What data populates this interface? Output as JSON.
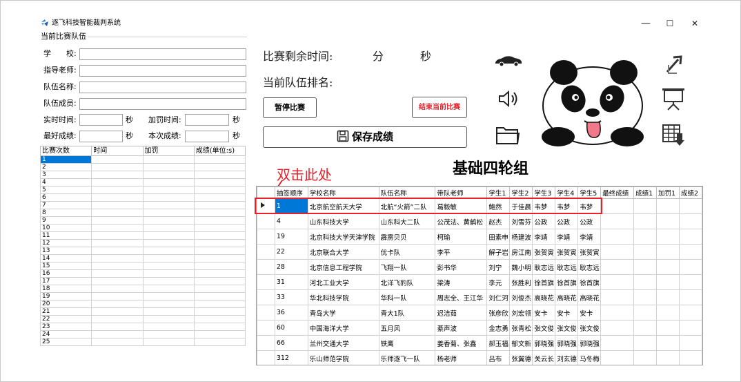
{
  "window": {
    "title": "逐飞科技智能裁判系统",
    "minimize": "—",
    "maximize": "☐",
    "close": "✕"
  },
  "left_panel": {
    "group_title": "当前比赛队伍",
    "school_label": "学　　校:",
    "teacher_label": "指导老师:",
    "team_name_label": "队伍名称:",
    "members_label": "队伍成员:",
    "realtime_label": "实时时间:",
    "penalty_time_label": "加罚时间:",
    "best_label": "最好成绩:",
    "this_label": "本次成绩:",
    "sec": "秒",
    "record_table": {
      "columns": [
        "比赛次数",
        "时间",
        "加罚",
        "成绩(单位:s)"
      ],
      "rows": [
        "1",
        "2",
        "3",
        "4",
        "5",
        "6",
        "7",
        "8",
        "9",
        "10",
        "11",
        "12",
        "13",
        "14",
        "15",
        "16",
        "17",
        "18",
        "19",
        "20",
        "21",
        "22",
        "23",
        "24",
        "25"
      ]
    }
  },
  "center": {
    "remaining_label": "比赛剩余时间:",
    "minute_unit": "分",
    "second_unit": "秒",
    "rank_label": "当前队伍排名:",
    "pause_button": "暂停比赛",
    "end_button": "结束当前比赛",
    "save_button": "保存成绩",
    "group_title": "基础四轮组",
    "annotation": "双击此处"
  },
  "grid": {
    "columns": [
      "抽签顺序",
      "学校名称",
      "队伍名称",
      "带队老师",
      "学生1",
      "学生2",
      "学生3",
      "学生4",
      "学生5",
      "最终成绩",
      "成绩1",
      "加罚1",
      "成绩2"
    ],
    "rows": [
      [
        "1",
        "北京航空航天大学",
        "北航“火箭”二队",
        "葛毅敏",
        "鲍然",
        "于佳晨",
        "韦梦",
        "韦梦",
        "韦梦"
      ],
      [
        "4",
        "山东科技大学",
        "山东科大二队",
        "公茂法、黄鹤松",
        "赵杰",
        "刘雪芬",
        "公政",
        "公政",
        "公政"
      ],
      [
        "19",
        "北京科技大学天津学院",
        "霹雳贝贝",
        "柯瑜",
        "田素申",
        "杨建波",
        "李靖",
        "李靖",
        "李靖"
      ],
      [
        "22",
        "北京联合大学",
        "优卡队",
        "李平",
        "解子岩",
        "房江南",
        "张贺寅",
        "张贺寅",
        "张贺寅"
      ],
      [
        "28",
        "北京信息工程学院",
        "飞翔一队",
        "彭书华",
        "刘宁",
        "魏小明",
        "耿志远",
        "耿志远",
        "耿志远"
      ],
      [
        "31",
        "河北工业大学",
        "北洋飞豹队",
        "梁涛",
        "李元",
        "张胜利",
        "徐首旗",
        "徐首旗",
        "徐首旗"
      ],
      [
        "33",
        "华北科技学院",
        "华科一队",
        "周志全、王江华",
        "刘仁河",
        "刘俊杰",
        "高晓花",
        "高晓花",
        "高晓花"
      ],
      [
        "36",
        "青岛大学",
        "青大1队",
        "迟洁茹",
        "张彦欣",
        "刘宏领",
        "安卡",
        "安卡",
        "安卡"
      ],
      [
        "60",
        "中国海洋大学",
        "五月风",
        "綦声波",
        "金志勇",
        "张青松",
        "张文俊",
        "张文俊",
        "张文俊"
      ],
      [
        "66",
        "兰州交通大学",
        "铁鹰",
        "姜香菊、张鑫",
        "郝玉福",
        "郁文新",
        "郭晓强",
        "郭晓强",
        "郭晓强"
      ],
      [
        "312",
        "乐山师范学院",
        "乐师逐飞一队",
        "杨老师",
        "吕布",
        "张翼德",
        "关云长",
        "刘玄德",
        "马冬梅"
      ]
    ]
  },
  "colors": {
    "selection": "#0078d7",
    "annotation": "#e8202a",
    "end_button_text": "#e8202a"
  },
  "icons": [
    "app-logo-icon",
    "car-icon",
    "speaker-icon",
    "folder-icon",
    "panda-image",
    "export-arrow-icon",
    "presentation-icon",
    "table-download-icon",
    "save-disk-icon"
  ]
}
